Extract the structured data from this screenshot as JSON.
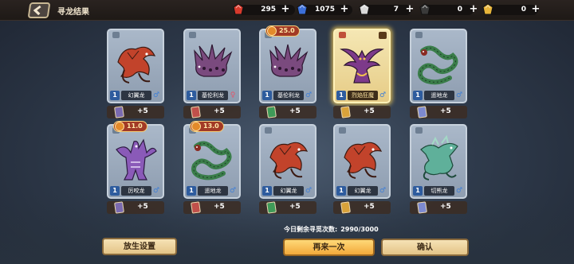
{
  "header": {
    "title": "寻龙结果"
  },
  "resources": [
    {
      "icon": "red-gem-icon",
      "value": "295",
      "color": "#d83a2c"
    },
    {
      "icon": "blue-crystal-icon",
      "value": "1075",
      "color": "#3c6fd8"
    },
    {
      "icon": "white-fossil-icon",
      "value": "7",
      "color": "#d9d9d9"
    },
    {
      "icon": "black-ore-icon",
      "value": "0",
      "color": "#3a3a3a"
    },
    {
      "icon": "gold-treasure-icon",
      "value": "0",
      "color": "#e8b53a"
    }
  ],
  "cards": [
    {
      "name": "幻翼龙",
      "level": "1",
      "gender": "male",
      "reward": "+5",
      "cost": "",
      "highlight": false,
      "dragon": "red-dragon",
      "color": "#c2432b"
    },
    {
      "name": "基伦利龙",
      "level": "1",
      "gender": "female",
      "reward": "+5",
      "cost": "",
      "highlight": false,
      "dragon": "purple-dragon",
      "color": "#7a4a7e"
    },
    {
      "name": "基伦利龙",
      "level": "1",
      "gender": "male",
      "reward": "+5",
      "cost": "25.0",
      "highlight": false,
      "dragon": "purple-dragon",
      "color": "#7a4a7e"
    },
    {
      "name": "烈焰狂魔",
      "level": "1",
      "gender": "male",
      "reward": "+5",
      "cost": "",
      "highlight": true,
      "dragon": "flame-demon",
      "color": "#7d3a8a"
    },
    {
      "name": "遥地龙",
      "level": "1",
      "gender": "male",
      "reward": "+5",
      "cost": "",
      "highlight": false,
      "dragon": "green-serpent",
      "color": "#3a7d4a"
    },
    {
      "name": "厉咬龙",
      "level": "1",
      "gender": "male",
      "reward": "+5",
      "cost": "11.0",
      "highlight": false,
      "dragon": "violet-dragon",
      "color": "#8a5ab8"
    },
    {
      "name": "遥地龙",
      "level": "1",
      "gender": "male",
      "reward": "+5",
      "cost": "13.0",
      "highlight": false,
      "dragon": "green-serpent",
      "color": "#3a7d4a"
    },
    {
      "name": "幻翼龙",
      "level": "1",
      "gender": "male",
      "reward": "+5",
      "cost": "",
      "highlight": false,
      "dragon": "red-dragon",
      "color": "#c2432b"
    },
    {
      "name": "幻翼龙",
      "level": "1",
      "gender": "male",
      "reward": "+5",
      "cost": "",
      "highlight": false,
      "dragon": "red-dragon",
      "color": "#c2432b"
    },
    {
      "name": "切熊龙",
      "level": "1",
      "gender": "male",
      "reward": "+5",
      "cost": "",
      "highlight": false,
      "dragon": "jade-dragon",
      "color": "#5fb09a"
    }
  ],
  "footer": {
    "remain_label": "今日剩余寻觅次数:",
    "remain_value": "2990/3000",
    "release_button": "放生设置",
    "again_button": "再来一次",
    "confirm_button": "确认"
  }
}
